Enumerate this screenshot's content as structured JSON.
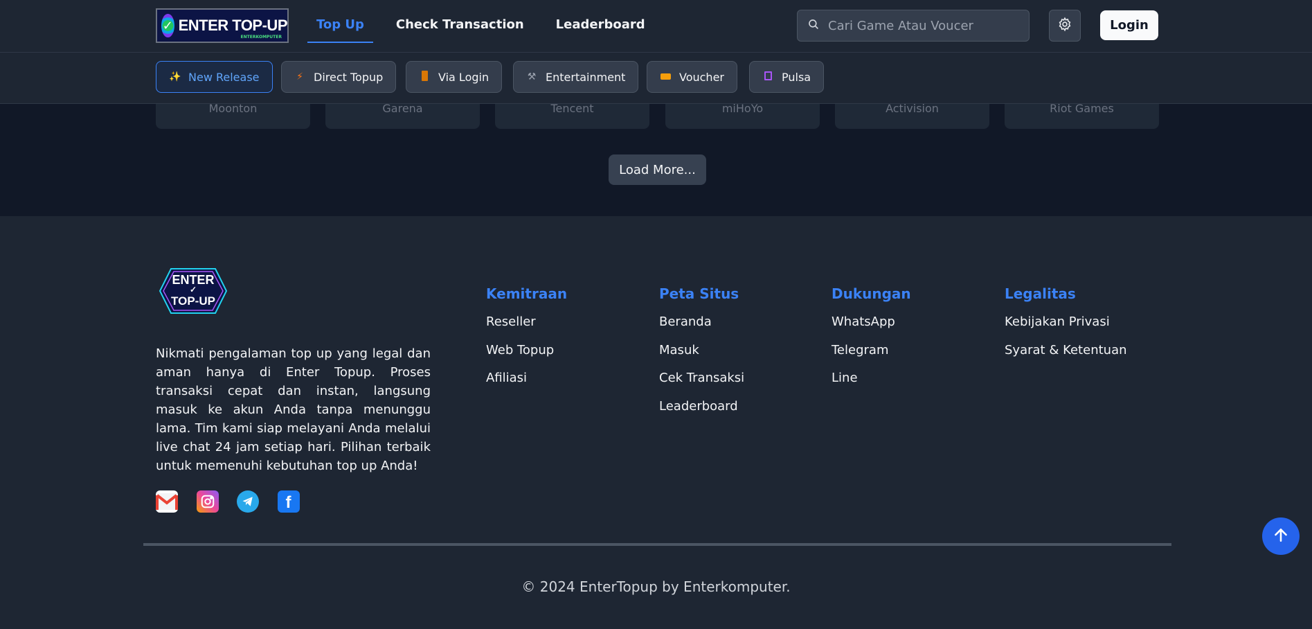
{
  "header": {
    "logo_text": "ENTER TOP-UP",
    "logo_sub": "ENTERKOMPUTER",
    "nav": [
      {
        "label": "Top Up",
        "active": true
      },
      {
        "label": "Check Transaction",
        "active": false
      },
      {
        "label": "Leaderboard",
        "active": false
      }
    ],
    "search_placeholder": "Cari Game Atau Voucer",
    "login_label": "Login"
  },
  "categories": [
    {
      "label": "New Release",
      "icon": "sparkles-icon",
      "active": true
    },
    {
      "label": "Direct Topup",
      "icon": "bolt-icon",
      "active": false
    },
    {
      "label": "Via Login",
      "icon": "door-icon",
      "active": false
    },
    {
      "label": "Entertainment",
      "icon": "hammer-icon",
      "active": false
    },
    {
      "label": "Voucher",
      "icon": "ticket-icon",
      "active": false
    },
    {
      "label": "Pulsa",
      "icon": "abacus-icon",
      "active": false
    }
  ],
  "publishers": [
    "Moonton",
    "Garena",
    "Tencent",
    "miHoYo",
    "Activision",
    "Riot Games"
  ],
  "load_more_label": "Load More...",
  "footer": {
    "logo_text_top": "ENTER",
    "logo_text_bottom": "TOP-UP",
    "description": "Nikmati pengalaman top up yang legal dan aman hanya di Enter Topup. Proses transaksi cepat dan instan, langsung masuk ke akun Anda tanpa menunggu lama. Tim kami siap melayani Anda melalui live chat 24 jam setiap hari. Pilihan terbaik untuk memenuhi kebutuhan top up Anda!",
    "columns": [
      {
        "title": "Kemitraan",
        "links": [
          "Reseller",
          "Web Topup",
          "Afiliasi"
        ]
      },
      {
        "title": "Peta Situs",
        "links": [
          "Beranda",
          "Masuk",
          "Cek Transaksi",
          "Leaderboard"
        ]
      },
      {
        "title": "Dukungan",
        "links": [
          "WhatsApp",
          "Telegram",
          "Line"
        ]
      },
      {
        "title": "Legalitas",
        "links": [
          "Kebijakan Privasi",
          "Syarat & Ketentuan"
        ]
      }
    ],
    "socials": [
      "gmail-icon",
      "instagram-icon",
      "telegram-icon",
      "facebook-icon"
    ],
    "copyright": "© 2024 EnterTopup by Enterkomputer."
  },
  "colors": {
    "accent": "#3b82f6",
    "background": "#1e2633",
    "content_bg": "#111827",
    "scroll_top_button": "#2563eb"
  }
}
